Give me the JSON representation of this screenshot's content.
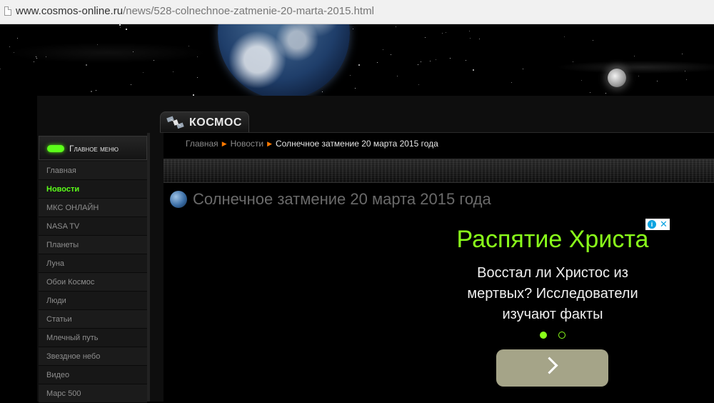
{
  "browser": {
    "url_host": "www.cosmos-online.ru",
    "url_path": "/news/528-colnechnoe-zatmenie-20-marta-2015.html"
  },
  "site": {
    "tab_label": "КОСМОС"
  },
  "sidebar": {
    "header": "Главное меню",
    "items": [
      {
        "label": "Главная",
        "active": false
      },
      {
        "label": "Новости",
        "active": true
      },
      {
        "label": "МКС ОНЛАЙН",
        "active": false
      },
      {
        "label": "NASA TV",
        "active": false
      },
      {
        "label": "Планеты",
        "active": false
      },
      {
        "label": "Луна",
        "active": false
      },
      {
        "label": "Обои Космос",
        "active": false
      },
      {
        "label": "Люди",
        "active": false
      },
      {
        "label": "Статьи",
        "active": false
      },
      {
        "label": "Млечный путь",
        "active": false
      },
      {
        "label": "Звездное небо",
        "active": false
      },
      {
        "label": "Видео",
        "active": false
      },
      {
        "label": "Марс 500",
        "active": false
      }
    ]
  },
  "breadcrumb": {
    "home": "Главная",
    "section": "Новости",
    "current": "Солнечное затмение 20 марта 2015 года"
  },
  "article": {
    "title": "Солнечное затмение 20 марта 2015 года"
  },
  "ad": {
    "headline": "Распятие Христа",
    "body": "Восстал ли Христос из мертвых? Исследователи изучают факты",
    "info_icon": "i",
    "close_glyph": "✕",
    "carousel": {
      "count": 2,
      "current": 1
    }
  },
  "colors": {
    "accent_green": "#8aff1a",
    "menu_active": "#5cff1a",
    "breadcrumb_separator": "#ff7a00",
    "ad_button": "#a5a488"
  }
}
